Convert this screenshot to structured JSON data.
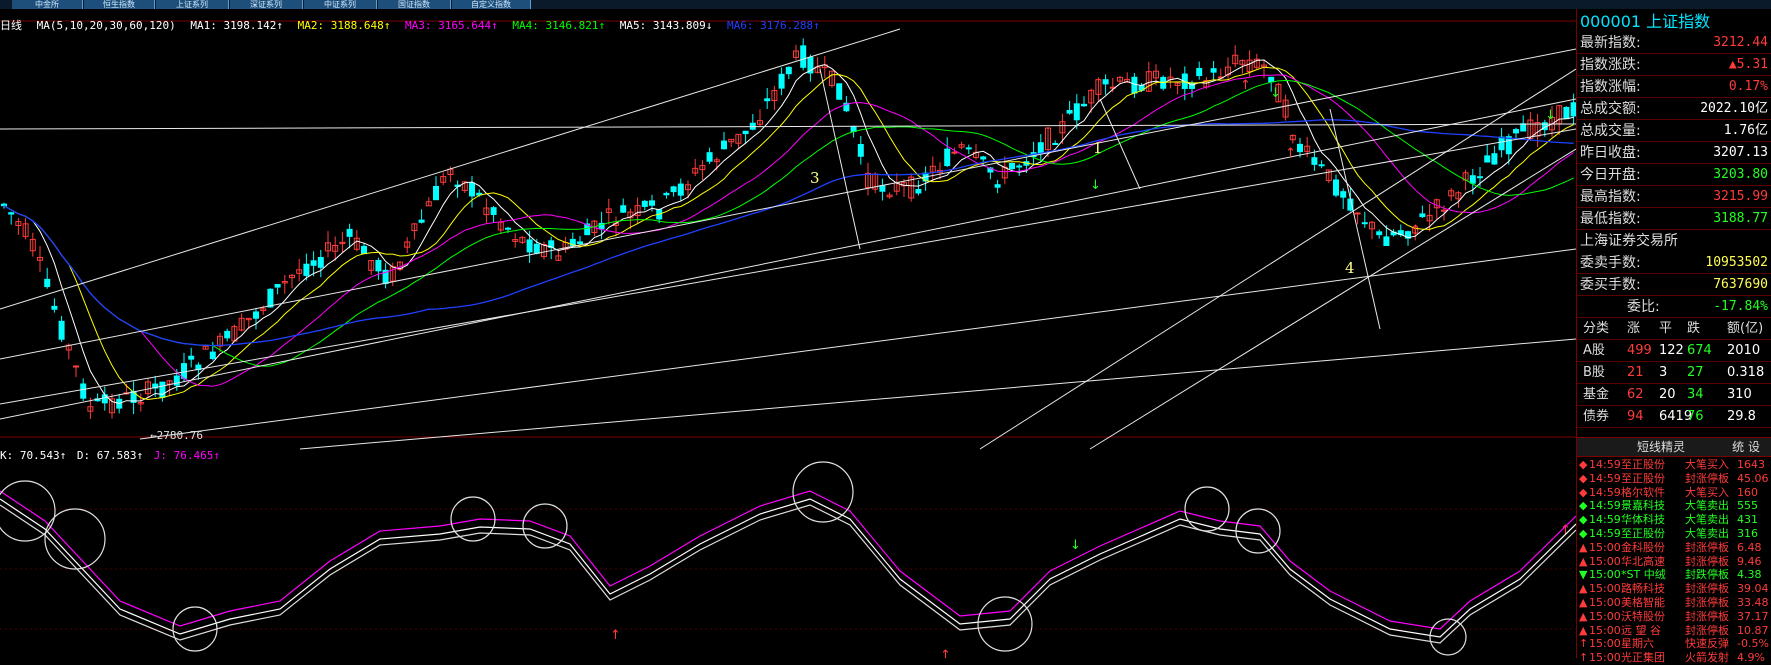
{
  "tabs": [
    "中金所",
    "恒生指数",
    "上证系列",
    "深证系列",
    "中证系列",
    "国证指数",
    "自定义指数"
  ],
  "ma_bar": {
    "period": "日线",
    "ma_def": "MA(5,10,20,30,60,120)",
    "ma1": "MA1: 3198.142↑",
    "ma2": "MA2: 3188.648↑",
    "ma3": "MA3: 3165.644↑",
    "ma4": "MA4: 3146.821↑",
    "ma5": "MA5: 3143.809↓",
    "ma6": "MA6: 3176.288↑"
  },
  "kdj_bar": {
    "k": "K: 70.543↑",
    "d": "D: 67.583↑",
    "j": "J: 76.465↑"
  },
  "annotations": {
    "low_price": "←2780.76",
    "wave1": "1",
    "wave3": "3",
    "wave4": "4"
  },
  "colors": {
    "bull": "#ff3b3b",
    "bear": "#00ffff",
    "ma1": "#ffffff",
    "ma2": "#ffff00",
    "ma3": "#ff00ff",
    "ma4": "#00ff00",
    "ma5": "#2040ff",
    "panel_border": "#7a0000"
  },
  "quote": {
    "code": "000001",
    "name": "上证指数",
    "rows": [
      {
        "label": "最新指数:",
        "value": "3212.44",
        "color": "red"
      },
      {
        "label": "指数涨跌:",
        "value": "▲5.31",
        "color": "red"
      },
      {
        "label": "指数涨幅:",
        "value": "0.17%",
        "color": "red"
      },
      {
        "label": "总成交额:",
        "value": "2022.10亿",
        "color": "white"
      },
      {
        "label": "总成交量:",
        "value": "1.76亿",
        "color": "white"
      },
      {
        "label": "昨日收盘:",
        "value": "3207.13",
        "color": "white"
      },
      {
        "label": "今日开盘:",
        "value": "3203.80",
        "color": "green"
      },
      {
        "label": "最高指数:",
        "value": "3215.99",
        "color": "red"
      },
      {
        "label": "最低指数:",
        "value": "3188.77",
        "color": "green"
      }
    ],
    "exchange": "上海证券交易所",
    "order_rows": [
      {
        "label": "委卖手数:",
        "value": "10953502",
        "color": "yellow"
      },
      {
        "label": "委买手数:",
        "value": "7637690",
        "color": "yellow"
      },
      {
        "label": "委比:",
        "value": "-17.84%",
        "color": "green"
      }
    ]
  },
  "breadth": {
    "headers": [
      "分类",
      "涨",
      "平",
      "跌",
      "额(亿)"
    ],
    "rows": [
      {
        "cat": "A股",
        "up": "499",
        "flat": "122",
        "down": "674",
        "amt": "2010"
      },
      {
        "cat": "B股",
        "up": "21",
        "flat": "3",
        "down": "27",
        "amt": "0.318"
      },
      {
        "cat": "基金",
        "up": "62",
        "flat": "20",
        "down": "34",
        "amt": "310"
      },
      {
        "cat": "债券",
        "up": "94",
        "flat": "6419",
        "down": "76",
        "amt": "29.8"
      }
    ]
  },
  "feed": {
    "title": "短线精灵",
    "title_right": "统 设",
    "items": [
      {
        "icon": "◆",
        "time": "14:59",
        "name": "至正股份",
        "event": "大笔买入",
        "val": "1643",
        "color": "red"
      },
      {
        "icon": "◆",
        "time": "14:59",
        "name": "至正股份",
        "event": "封涨停板",
        "val": "45.06",
        "color": "red"
      },
      {
        "icon": "◆",
        "time": "14:59",
        "name": "格尔软件",
        "event": "大笔买入",
        "val": "160",
        "color": "red"
      },
      {
        "icon": "◆",
        "time": "14:59",
        "name": "景嘉科技",
        "event": "大笔卖出",
        "val": "555",
        "color": "green"
      },
      {
        "icon": "◆",
        "time": "14:59",
        "name": "华体科技",
        "event": "大笔卖出",
        "val": "431",
        "color": "green"
      },
      {
        "icon": "◆",
        "time": "14:59",
        "name": "至正股份",
        "event": "大笔卖出",
        "val": "316",
        "color": "green"
      },
      {
        "icon": "▲",
        "time": "15:00",
        "name": "金科股份",
        "event": "封涨停板",
        "val": "6.48",
        "color": "red"
      },
      {
        "icon": "▲",
        "time": "15:00",
        "name": "华北高速",
        "event": "封涨停板",
        "val": "9.46",
        "color": "red"
      },
      {
        "icon": "▼",
        "time": "15:00",
        "name": "*ST 中绒",
        "event": "封跌停板",
        "val": "4.38",
        "color": "green"
      },
      {
        "icon": "▲",
        "time": "15:00",
        "name": "路畅科技",
        "event": "封涨停板",
        "val": "39.04",
        "color": "red"
      },
      {
        "icon": "▲",
        "time": "15:00",
        "name": "美格智能",
        "event": "封涨停板",
        "val": "33.48",
        "color": "red"
      },
      {
        "icon": "▲",
        "time": "15:00",
        "name": "沃特股份",
        "event": "封涨停板",
        "val": "37.17",
        "color": "red"
      },
      {
        "icon": "▲",
        "time": "15:00",
        "name": "远 望 谷",
        "event": "封涨停板",
        "val": "10.87",
        "color": "red"
      },
      {
        "icon": "↑",
        "time": "15:00",
        "name": "星期六",
        "event": "快速反弹",
        "val": "-0.5%",
        "color": "red"
      },
      {
        "icon": "↑",
        "time": "15:00",
        "name": "光正集团",
        "event": "火箭发射",
        "val": "4.9%",
        "color": "red"
      }
    ]
  }
}
